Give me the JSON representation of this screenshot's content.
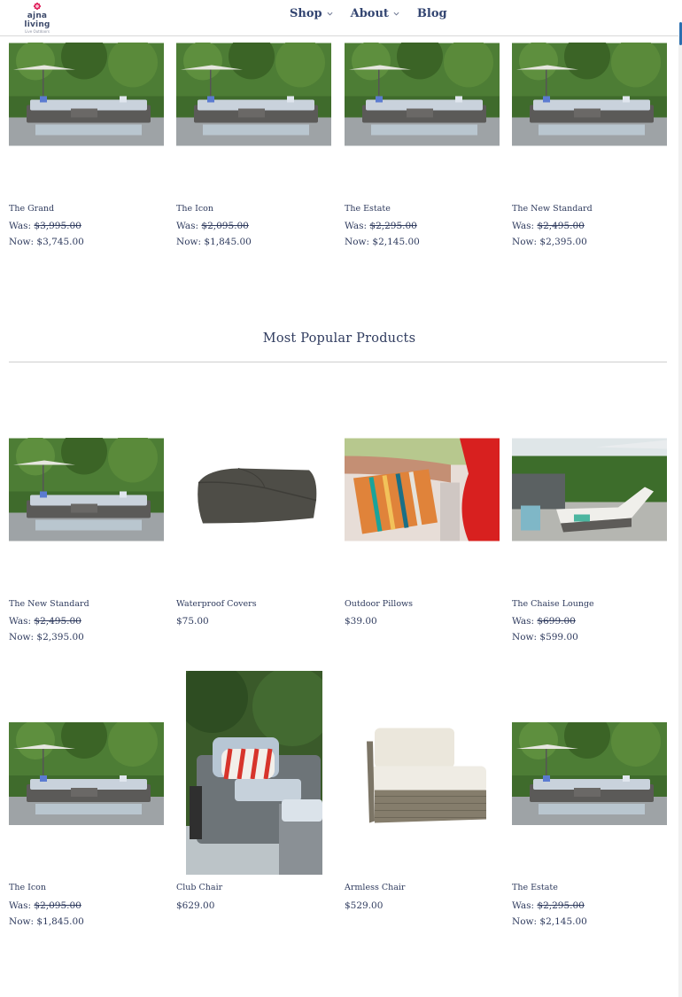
{
  "header": {
    "logo_text": "ajna living",
    "logo_sub": "Live Outdoors",
    "nav": [
      {
        "label": "Shop",
        "has_dropdown": true
      },
      {
        "label": "About",
        "has_dropdown": true
      },
      {
        "label": "Blog",
        "has_dropdown": false
      }
    ]
  },
  "top_row": [
    {
      "name": "The Grand",
      "was_label": "Was:",
      "was": "$3,995.00",
      "now_label": "Now:",
      "now": "$3,745.00",
      "image": "patio-sectional"
    },
    {
      "name": "The Icon",
      "was_label": "Was:",
      "was": "$2,095.00",
      "now_label": "Now:",
      "now": "$1,845.00",
      "image": "patio-sectional"
    },
    {
      "name": "The Estate",
      "was_label": "Was:",
      "was": "$2,295.00",
      "now_label": "Now:",
      "now": "$2,145.00",
      "image": "patio-sectional"
    },
    {
      "name": "The New Standard",
      "was_label": "Was:",
      "was": "$2,495.00",
      "now_label": "Now:",
      "now": "$2,395.00",
      "image": "patio-sectional"
    }
  ],
  "popular": {
    "title": "Most Popular Products",
    "row1": [
      {
        "name": "The New Standard",
        "was_label": "Was:",
        "was": "$2,495.00",
        "now_label": "Now:",
        "now": "$2,395.00",
        "image": "patio-sectional"
      },
      {
        "name": "Waterproof Covers",
        "price": "$75.00",
        "image": "furniture-cover"
      },
      {
        "name": "Outdoor Pillows",
        "price": "$39.00",
        "image": "striped-pillow"
      },
      {
        "name": "The Chaise Lounge",
        "was_label": "Was:",
        "was": "$699.00",
        "now_label": "Now:",
        "now": "$599.00",
        "image": "chaise-lounge"
      }
    ],
    "row2": [
      {
        "name": "The Icon",
        "was_label": "Was:",
        "was": "$2,095.00",
        "now_label": "Now:",
        "now": "$1,845.00",
        "image": "patio-sectional"
      },
      {
        "name": "Club Chair",
        "price": "$629.00",
        "image": "club-chair"
      },
      {
        "name": "Armless Chair",
        "price": "$529.00",
        "image": "armless-chair"
      },
      {
        "name": "The Estate",
        "was_label": "Was:",
        "was": "$2,295.00",
        "now_label": "Now:",
        "now": "$2,145.00",
        "image": "patio-sectional"
      }
    ]
  },
  "colors": {
    "text": "#2f3b5e",
    "nav": "#334571",
    "accent": "#e0245e",
    "rule": "#cfcfcf"
  }
}
